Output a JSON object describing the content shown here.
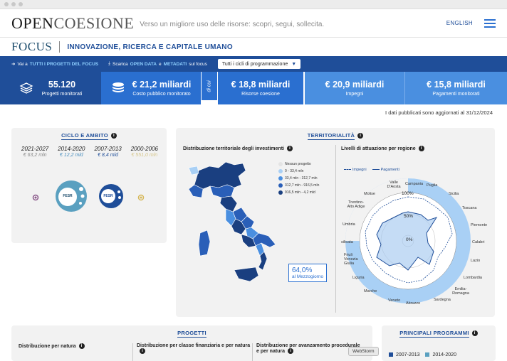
{
  "header": {
    "logo_bold": "OPEN",
    "logo_light": "COESIONE",
    "tagline": "Verso un migliore uso delle risorse: scopri, segui, sollecita.",
    "language": "ENGLISH"
  },
  "focus": {
    "word": "FOCUS",
    "title": "INNOVAZIONE, RICERCA E CAPITALE UMANO"
  },
  "actions": {
    "prefix1": "Vai a",
    "link1": "TUTTI I PROGETTI DEL FOCUS",
    "prefix2": "Scarica",
    "link2": "OPEN DATA",
    "mid2": "e",
    "link3": "METADATI",
    "suffix2": "sul focus",
    "cycle_select": "Tutti i cicli di programmazione"
  },
  "stats": {
    "projects_value": "55.120",
    "projects_label": "Progetti monitorati",
    "cost_value": "€ 21,2 miliardi",
    "cost_label": "Costo pubblico monitorato",
    "dicui": "di cui",
    "cohesion_value": "€ 18,8 miliardi",
    "cohesion_label": "Risorse coesione",
    "commitments_value": "€ 20,9 miliardi",
    "commitments_label": "Impegni",
    "payments_value": "€ 15,8 miliardi",
    "payments_label": "Pagamenti monitorati"
  },
  "updated": "I dati pubblicati sono aggiornati al 31/12/2024",
  "cycle_card": {
    "title": "CICLO E AMBITO",
    "cycles": [
      {
        "year": "2021-2027",
        "amount": "€ 63,2 mln",
        "color": "#888888"
      },
      {
        "year": "2014-2020",
        "amount": "€ 12,2 mld",
        "color": "#4a8fbf"
      },
      {
        "year": "2007-2013",
        "amount": "€ 8,4 mld",
        "color": "#1f4e99"
      },
      {
        "year": "2000-2006",
        "amount": "€ 551,0 mln",
        "color": "#d6c68a"
      }
    ],
    "bubble1": "FESR",
    "bubble2": "FESR"
  },
  "territory_card": {
    "title": "TERRITORIALITÀ",
    "map_title": "Distribuzione territoriale degli investimenti",
    "legend": [
      {
        "label": "Nessun progetto",
        "color": "#e4e4e4"
      },
      {
        "label": "0 - 33,4 mln",
        "color": "#a9d0f5"
      },
      {
        "label": "33,4 mln - 312,7 mln",
        "color": "#4a8fe0"
      },
      {
        "label": "312,7 mln - 916,5 mln",
        "color": "#2a5fb8"
      },
      {
        "label": "916,5 mln - 4,2 mld",
        "color": "#1a3f80"
      }
    ],
    "pct_value": "64,0%",
    "pct_label": "al Mezzogiorno",
    "radar_title": "Livelli di attuazione per regione",
    "radar_legend_commit": "Impegni",
    "radar_legend_pay": "Pagamenti",
    "ring_labels": [
      "100%",
      "50%",
      "0%"
    ],
    "regions": [
      "Campania",
      "Puglia",
      "Sicilia",
      "Toscana",
      "Piemonte",
      "Calabri",
      "Lazio",
      "Lombardia",
      "Emilia-Romagna",
      "Sardegna",
      "Abruzzo",
      "Veneto",
      "Marche",
      "Liguria",
      "Friuli Venezia Giulia",
      "silicata",
      "Umbria",
      "Trentino-Alto Adige",
      "Molise",
      "Valle D'Aosta"
    ]
  },
  "projects_card": {
    "title": "PROGETTI",
    "col1": "Distribuzione per natura",
    "col2": "Distribuzione per classe finanziaria e per natura",
    "col3": "Distribuzione per avanzamento procedurale e per natura",
    "tooltip": "WebStorm"
  },
  "programs_card": {
    "title": "PRINCIPALI PROGRAMMI",
    "legend1": "2007-2013",
    "legend2": "2014-2020",
    "color1": "#1f4e99",
    "color2": "#5aa0c0"
  }
}
